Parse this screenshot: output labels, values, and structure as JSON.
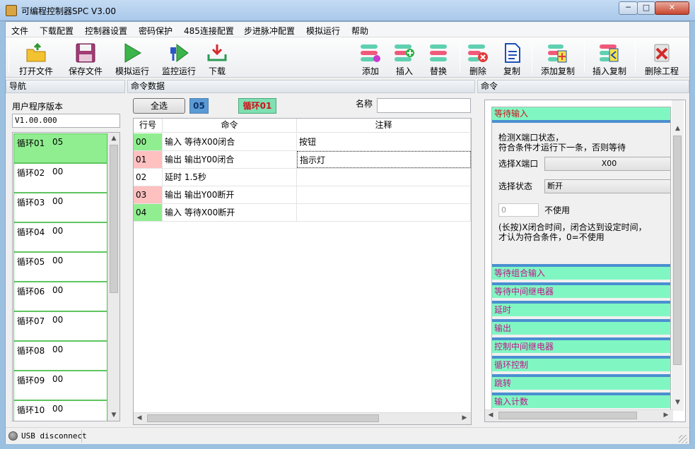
{
  "window": {
    "title": "可编程控制器SPC V3.00",
    "minimize": "─",
    "maximize": "□",
    "close": "✕"
  },
  "menu": [
    "文件",
    "下载配置",
    "控制器设置",
    "密码保护",
    "485连接配置",
    "步进脉冲配置",
    "模拟运行",
    "帮助"
  ],
  "toolbar": {
    "left": [
      {
        "label": "打开文件",
        "icon": "open-folder-icon"
      },
      {
        "label": "保存文件",
        "icon": "floppy-disk-icon"
      },
      {
        "label": "模拟运行",
        "icon": "play-icon"
      },
      {
        "label": "监控运行",
        "icon": "usb-play-icon"
      },
      {
        "label": "下载",
        "icon": "download-tray-icon"
      }
    ],
    "right": [
      {
        "label": "添加",
        "icon": "add-row-icon"
      },
      {
        "label": "插入",
        "icon": "insert-row-icon"
      },
      {
        "label": "替换",
        "icon": "replace-row-icon"
      },
      {
        "label": "删除",
        "icon": "delete-row-icon"
      },
      {
        "label": "复制",
        "icon": "copy-document-icon"
      },
      {
        "label": "添加复制",
        "icon": "add-copy-icon"
      },
      {
        "label": "插入复制",
        "icon": "insert-copy-icon"
      },
      {
        "label": "删除工程",
        "icon": "delete-project-icon"
      }
    ]
  },
  "panes": {
    "nav": "导航",
    "data": "命令数据",
    "command": "命令"
  },
  "nav": {
    "version_label": "用户程序版本",
    "version_value": "V1.00.000",
    "loops": [
      {
        "name": "循环01",
        "count": "05"
      },
      {
        "name": "循环02",
        "count": "00"
      },
      {
        "name": "循环03",
        "count": "00"
      },
      {
        "name": "循环04",
        "count": "00"
      },
      {
        "name": "循环05",
        "count": "00"
      },
      {
        "name": "循环06",
        "count": "00"
      },
      {
        "name": "循环07",
        "count": "00"
      },
      {
        "name": "循环08",
        "count": "00"
      },
      {
        "name": "循环09",
        "count": "00"
      },
      {
        "name": "循环10",
        "count": "00"
      }
    ],
    "selected_index": 0
  },
  "data": {
    "select_all": "全选",
    "count": "05",
    "loop_badge": "循环01",
    "name_label": "名称",
    "name_value": "",
    "headers": {
      "no": "行号",
      "cmd": "命令",
      "note": "注释"
    },
    "rows": [
      {
        "no": "00",
        "cmd": "输入 等待X00闭合",
        "note": "按钮",
        "kind": "input"
      },
      {
        "no": "01",
        "cmd": "输出 输出Y00闭合",
        "note": "指示灯",
        "kind": "output"
      },
      {
        "no": "02",
        "cmd": "延时 1.5秒",
        "note": "",
        "kind": "delay"
      },
      {
        "no": "03",
        "cmd": "输出 输出Y00断开",
        "note": "",
        "kind": "output"
      },
      {
        "no": "04",
        "cmd": "输入 等待X00断开",
        "note": "",
        "kind": "input"
      }
    ]
  },
  "command": {
    "active_title": "等待输入",
    "desc": [
      "检测X端口状态，",
      "符合条件才运行下一条，否则等待"
    ],
    "port_label": "选择X端口",
    "port_value": "X00",
    "state_label": "选择状态",
    "state_value": "断开",
    "delay_value": "0",
    "delay_label": "不使用",
    "hint": [
      "(长按)X闭合时间，闭合达到设定时间，",
      "才认为符合条件，0=不使用"
    ],
    "categories": [
      "等待组合输入",
      "等待中间继电器",
      "延时",
      "输出",
      "控制中间继电器",
      "循环控制",
      "跳转",
      "输入计数"
    ]
  },
  "status": {
    "text": "USB disconnect"
  },
  "colors": {
    "input_row": "#90ee90",
    "output_row": "#ffc0c0",
    "category_bg": "#80f7c2",
    "category_border": "#4a8fd0"
  }
}
